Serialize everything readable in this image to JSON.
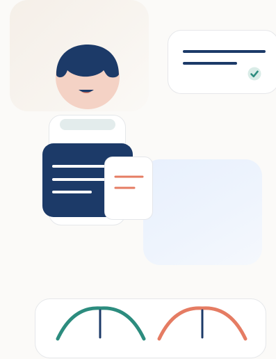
{
  "illustration": {
    "colors": {
      "navy": "#1c3a68",
      "teal": "#2c8c7e",
      "coral": "#e57c63",
      "skin": "#f4d2c5",
      "check_bg": "#d9ece7",
      "phone_bar": "#e3ecec",
      "card_border": "#e5e7ea"
    },
    "icons": [
      "avatar-face-icon",
      "check-icon",
      "gauge-icon"
    ],
    "gauges": [
      {
        "color": "teal",
        "level": 0.5
      },
      {
        "color": "coral",
        "level": 0.5
      }
    ]
  }
}
